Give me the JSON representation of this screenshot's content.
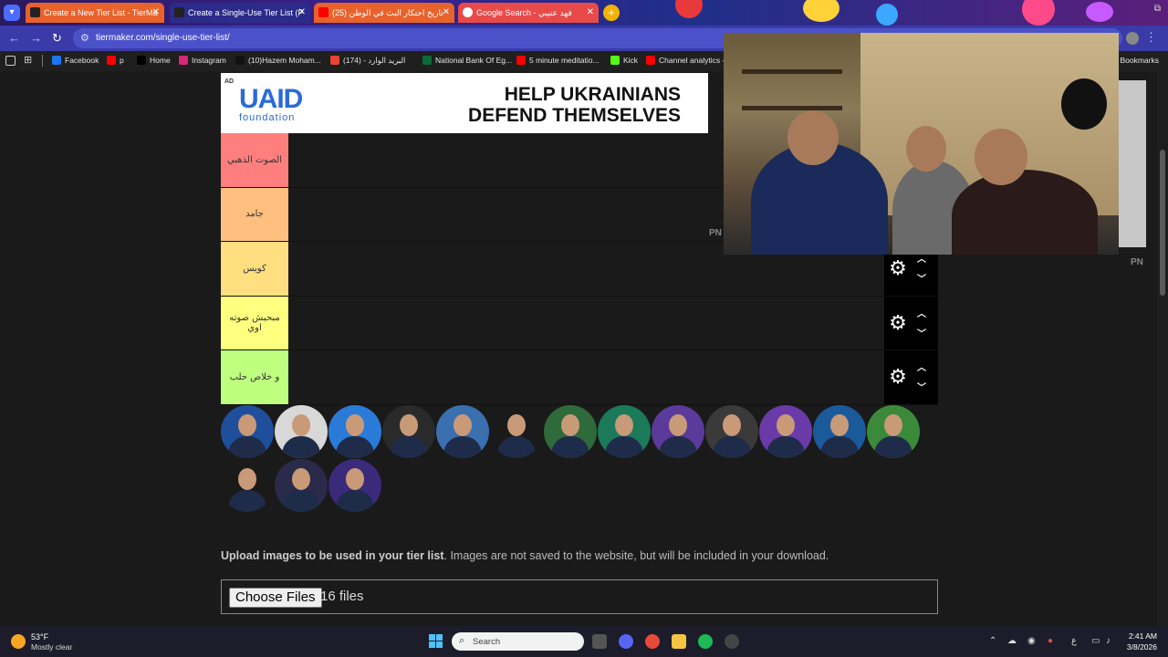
{
  "browser": {
    "tabs": [
      {
        "title": "Create a New Tier List - TierMa",
        "active": true,
        "color": "#e8622c"
      },
      {
        "title": "Create a Single-Use Tier List (P",
        "active": false,
        "color": "#3a3aa8"
      },
      {
        "title": "(25) تاريخ احتكار البث في الوطن",
        "active": false,
        "color": "#e8622c"
      },
      {
        "title": "Google Search - فهد عتيبي",
        "active": false,
        "color": "#e84a4a"
      }
    ],
    "url": "tiermaker.com/single-use-tier-list/",
    "new_tab_label": "+",
    "bookmarks": [
      {
        "label": "Facebook",
        "icon": "facebook-icon",
        "color": "#1877f2"
      },
      {
        "label": "p",
        "icon": "youtube-icon",
        "color": "#ff0000"
      },
      {
        "label": "Home",
        "icon": "x-icon",
        "color": "#000000"
      },
      {
        "label": "Instagram",
        "icon": "instagram-icon",
        "color": "#d62976"
      },
      {
        "label": "(10)Hazem Moham...",
        "icon": "tiktok-icon",
        "color": "#111111"
      },
      {
        "label": "(174) - البريد الوارد",
        "icon": "gmail-icon",
        "color": "#ea4335"
      },
      {
        "label": "National Bank Of Eg...",
        "icon": "bank-icon",
        "color": "#0a6b3a"
      },
      {
        "label": "5 minute meditatio...",
        "icon": "youtube-icon",
        "color": "#ff0000"
      },
      {
        "label": "Kick",
        "icon": "kick-icon",
        "color": "#53fc18"
      },
      {
        "label": "Channel analytics - ...",
        "icon": "youtube-icon",
        "color": "#ff0000"
      }
    ],
    "all_bookmarks": "ll Bookmarks"
  },
  "ad": {
    "tag": "AD",
    "logo": "UAID",
    "logo_sub": "foundation",
    "headline_1": "HELP UKRAINIANS",
    "headline_2": "DEFEND THEMSELVES"
  },
  "tiers": [
    {
      "label": "الصوت الذهبي",
      "color": "#ff7f7f"
    },
    {
      "label": "جامد",
      "color": "#ffbf7f"
    },
    {
      "label": "كويس",
      "color": "#ffdf7f"
    },
    {
      "label": "مبحبش صوته اوي",
      "color": "#ffff7f"
    },
    {
      "label": "و خلاص حلب",
      "color": "#bfff7f"
    }
  ],
  "pool_count": 16,
  "pool_colors": [
    "#1f4f9a",
    "#d8d8d8",
    "#2a7bd8",
    "#2a2a2a",
    "#3a6fb0",
    "#1a1a1a",
    "#2f6a3a",
    "#1a7a5a",
    "#5a3a9a",
    "#3a3a3a",
    "#6a3aa8",
    "#1a5a9a",
    "#3a8a3a",
    "#1a1a1a",
    "#2a2a4a",
    "#3a2a7a"
  ],
  "upload": {
    "bold": "Upload images to be used in your tier list",
    "rest": ". Images are not saved to the website, but will be included in your download.",
    "button": "Choose Files",
    "count": "16 files"
  },
  "watermark": "PN",
  "taskbar": {
    "temp": "53°F",
    "weather": "Mostly clear",
    "search": "Search",
    "time": "2:41 AM",
    "date": "3/8/2026",
    "lang": "ع"
  }
}
